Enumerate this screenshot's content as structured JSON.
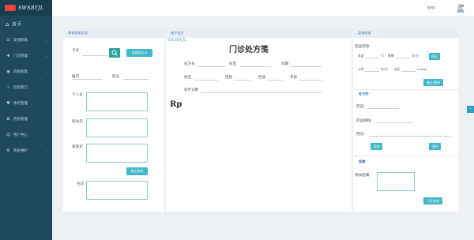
{
  "logo": {
    "text": "SWSBYJL"
  },
  "sidebar": {
    "home": "首 页",
    "items": [
      {
        "label": "反馈新歌",
        "icon": "list-icon"
      },
      {
        "label": "门诊管理",
        "icon": "clinic-icon"
      },
      {
        "label": "药组新歌",
        "icon": "pill-icon"
      },
      {
        "label": "药房窗口",
        "icon": "pharmacy-icon"
      },
      {
        "label": "体检管理",
        "icon": "checkup-icon"
      },
      {
        "label": "药房管理",
        "icon": "drug-icon"
      },
      {
        "label": "用户中心",
        "icon": "user-icon"
      },
      {
        "label": "系统维护",
        "icon": "settings-icon"
      }
    ]
  },
  "topbar": {
    "username": "管理员"
  },
  "patient": {
    "header": "患者基本信息",
    "card_label": "卡号",
    "read_card_button": "读取就诊卡",
    "native_label": "籍贯",
    "job_label": "职业",
    "personal_history_label": "个人史",
    "past_history_label": "既往史",
    "family_history_label": "家族史",
    "submit_button": "提交修改",
    "chief_complaint_label": "主诉"
  },
  "prescription": {
    "header": "电子处方",
    "watermark": "SWSBYJL",
    "title": "门诊处方笺",
    "rx_no_label": "处方号",
    "dept_label": "科室",
    "date_label": "日期",
    "name_label": "姓名",
    "gender_label": "性别",
    "ethnicity_label": "民族",
    "age_label": "年龄",
    "diagnosis_label": "初步诊断",
    "rx_symbol": "Rp"
  },
  "exam": {
    "header": "身体检查",
    "result_label": "检查结果:",
    "temp_label": "体温",
    "temp_unit": "℃",
    "pulse_label": "脉搏",
    "pulse_unit": "次/分",
    "save_button": "保存",
    "hr_label": "心率",
    "hr_unit": "次/分",
    "bp_label": "血压",
    "bp_unit": "mmHg",
    "confirm_button": "确认/更改"
  },
  "drug": {
    "header": "处方药",
    "name_label": "药品:",
    "spec_label": "药品规格:",
    "usage_label": "用法:",
    "add_button": "添加",
    "delete_button": "清除"
  },
  "advice": {
    "header": "医嘱",
    "add_label": "添加医嘱:",
    "finish_button": "门诊完成"
  }
}
